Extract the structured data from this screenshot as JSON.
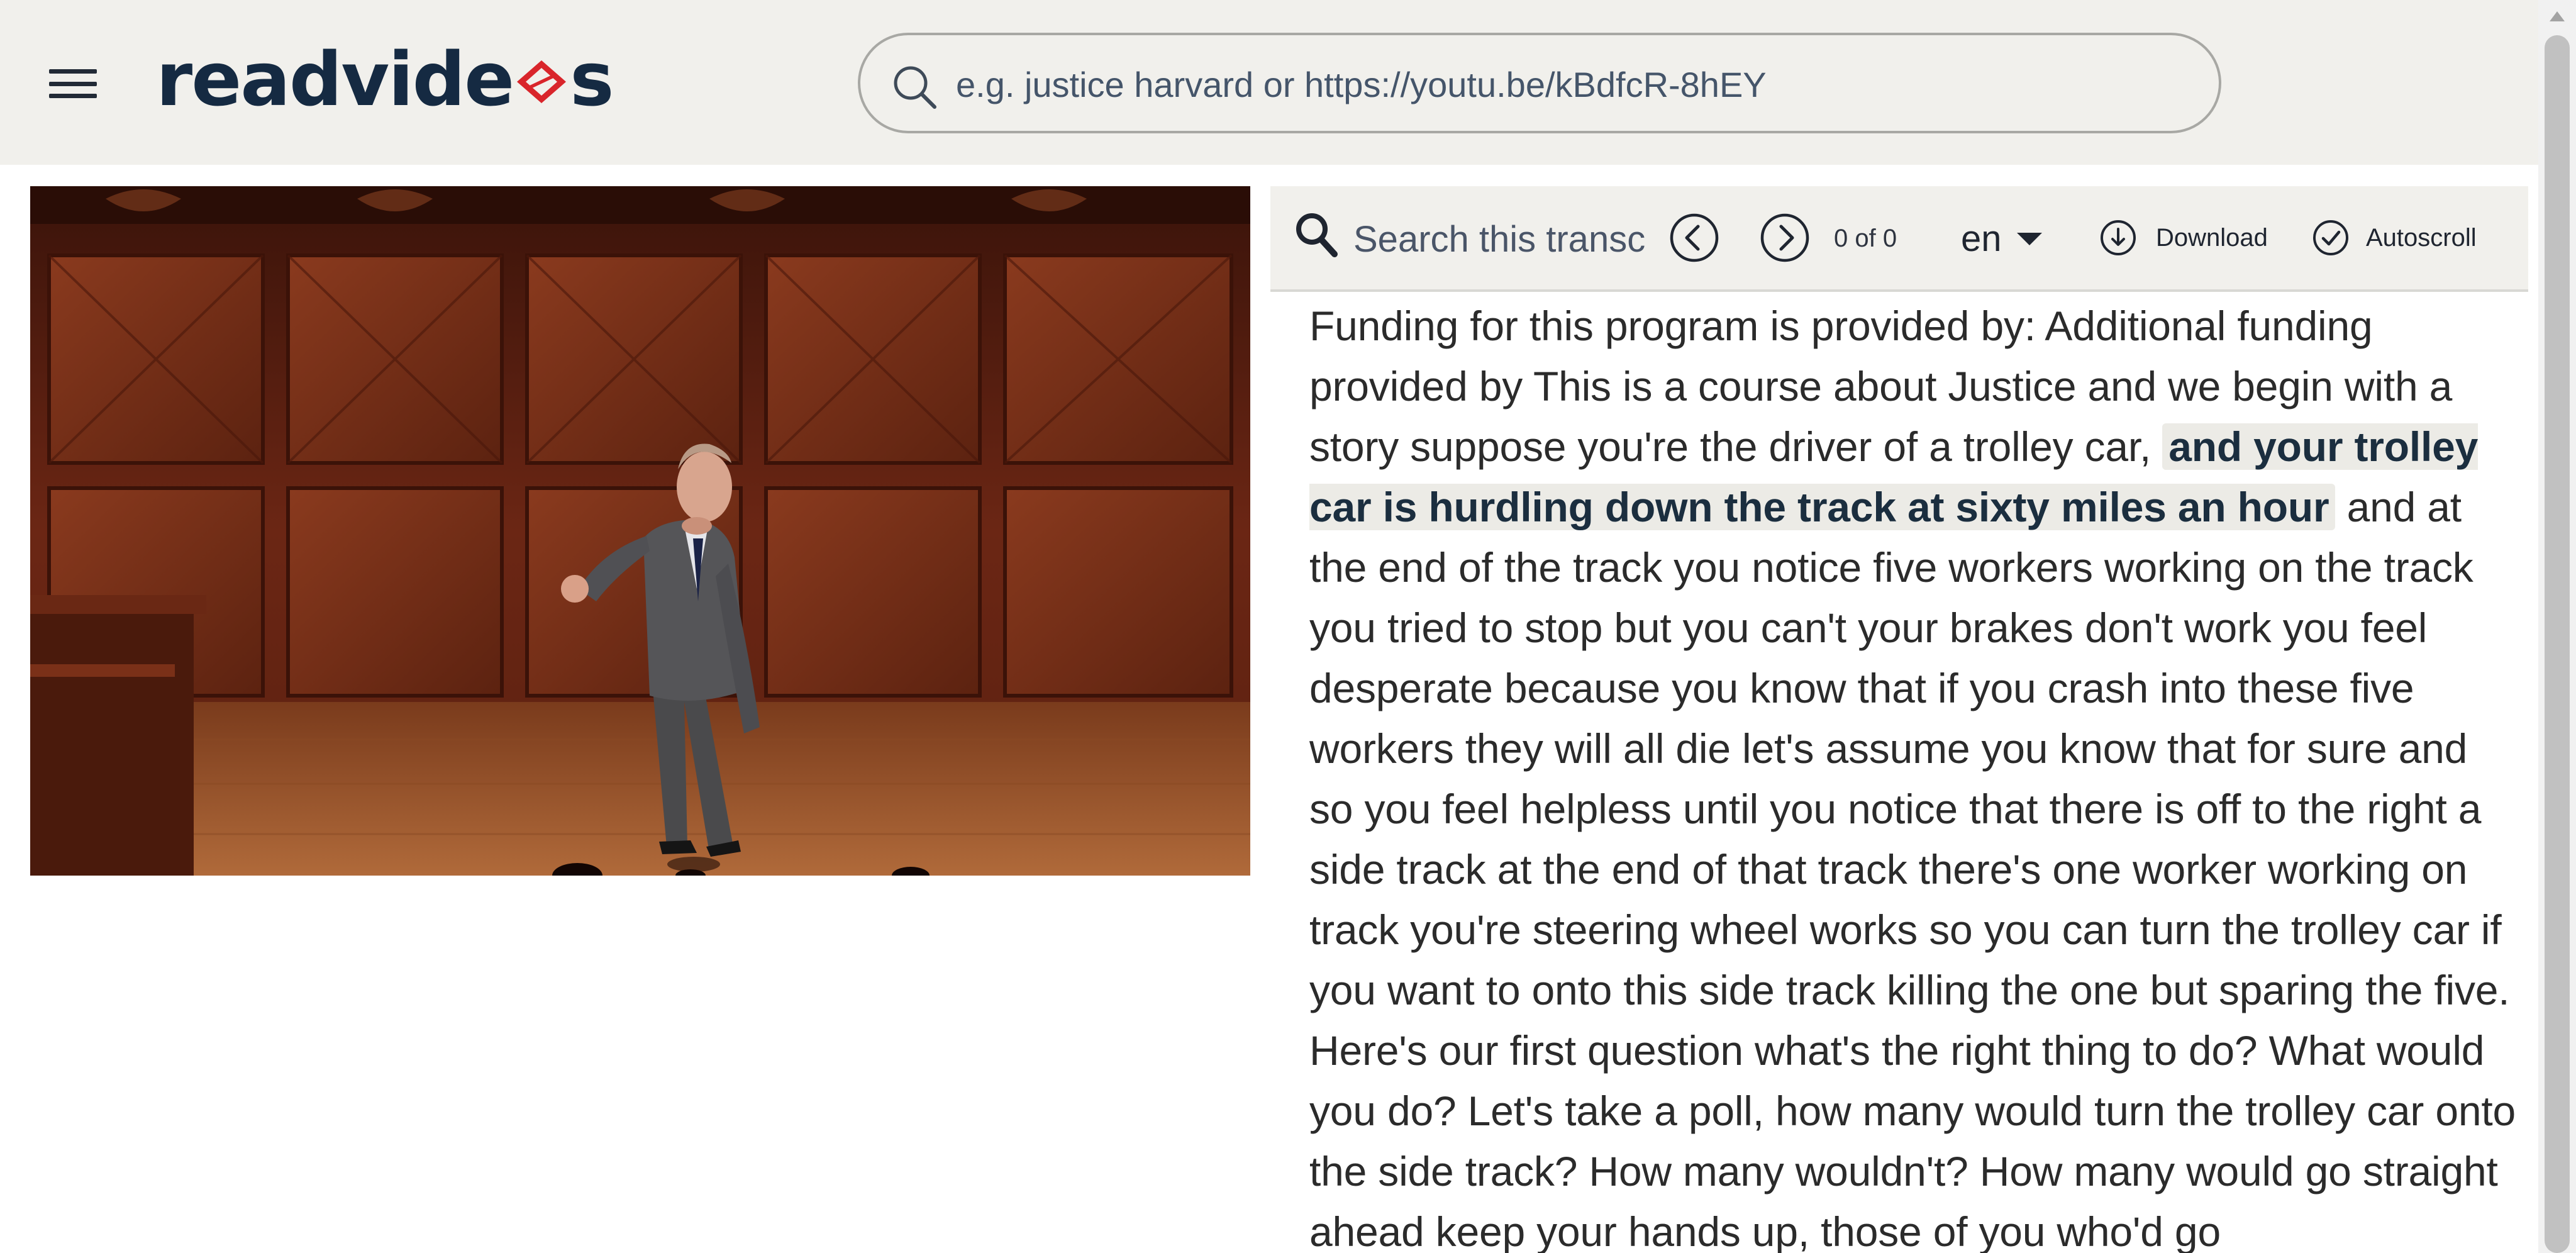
{
  "header": {
    "logo_text_before": "readvide",
    "logo_text_after": "s",
    "search_placeholder": "e.g. justice harvard or https://youtu.be/kBdfcR-8hEY",
    "colors": {
      "background": "#f1f0ec",
      "logo": "#152a42",
      "logo_accent": "#d9252b"
    }
  },
  "transcript_toolbar": {
    "search_placeholder": "Search this transcript",
    "prev_icon": "chevron-left-circle-icon",
    "next_icon": "chevron-right-circle-icon",
    "match_count": "0 of 0",
    "language": "en",
    "download_label": "Download",
    "autoscroll_label": "Autoscroll"
  },
  "transcript": {
    "segments": [
      {
        "text": "Funding for this program is provided by: Additional funding provided by This is a course about Justice and we begin with a story suppose you're the driver of a trolley car, ",
        "active": false
      },
      {
        "text": "and your trolley car is hurdling down the track at sixty miles an hour",
        "active": true
      },
      {
        "text": " and at the end of the track you notice five workers working on the track you tried to stop but you can't your brakes don't work you feel desperate because you know that if you crash into these five workers they will all die let's assume you know that for sure and so you feel helpless until you notice that there is off to the right a side track at the end of that track there's one worker working on track you're steering wheel works so you can turn the trolley car if you want to onto this side track killing the one but sparing the five. Here's our first question what's the right thing to do? What would you do? Let's take a poll, how many would turn the trolley car onto the side track? How many wouldn't? How many would go straight ahead keep your hands up, those of you who'd go",
        "active": false
      }
    ],
    "colors": {
      "active_background": "#ecebe6",
      "active_text": "#1b2e3f"
    }
  }
}
